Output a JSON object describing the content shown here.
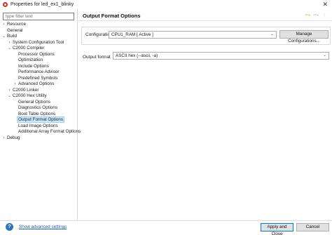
{
  "window": {
    "title": "Properties for led_ex1_blinky",
    "close_glyph": "✕"
  },
  "filter": {
    "placeholder": "type filter text",
    "value": ""
  },
  "tree": [
    {
      "label": "Resource",
      "toggle": "›",
      "depth": 0
    },
    {
      "label": "General",
      "toggle": "",
      "depth": 0
    },
    {
      "label": "Build",
      "toggle": "⌄",
      "depth": 0
    },
    {
      "label": "System Configuration Tool",
      "toggle": "›",
      "depth": 1
    },
    {
      "label": "C2000 Compiler",
      "toggle": "⌄",
      "depth": 1
    },
    {
      "label": "Processor Options",
      "toggle": "",
      "depth": 2
    },
    {
      "label": "Optimization",
      "toggle": "",
      "depth": 2
    },
    {
      "label": "Include Options",
      "toggle": "",
      "depth": 2
    },
    {
      "label": "Performance Advisor",
      "toggle": "",
      "depth": 2
    },
    {
      "label": "Predefined Symbols",
      "toggle": "",
      "depth": 2
    },
    {
      "label": "Advanced Options",
      "toggle": "›",
      "depth": 2
    },
    {
      "label": "C2000 Linker",
      "toggle": "›",
      "depth": 1
    },
    {
      "label": "C2000 Hex Utility",
      "toggle": "⌄",
      "depth": 1
    },
    {
      "label": "General Options",
      "toggle": "",
      "depth": 2
    },
    {
      "label": "Diagnostics Options",
      "toggle": "",
      "depth": 2
    },
    {
      "label": "Boot Table Options",
      "toggle": "",
      "depth": 2
    },
    {
      "label": "Output Format Options",
      "toggle": "",
      "depth": 2,
      "selected": true
    },
    {
      "label": "Load Image Options",
      "toggle": "",
      "depth": 2
    },
    {
      "label": "Additional Array Format Options",
      "toggle": "",
      "depth": 2
    },
    {
      "label": "Debug",
      "toggle": "›",
      "depth": 0
    }
  ],
  "page": {
    "title": "Output Format Options",
    "nav": {
      "back": "⇦",
      "back_menu": "▾",
      "forward": "⇨",
      "forward_menu": "▾",
      "more": "⋮"
    }
  },
  "configuration": {
    "label": "Configuration:",
    "value": "CPU1_RAM  [ Active ]",
    "manage_label": "Manage Configurations..."
  },
  "output_format": {
    "label": "Output format",
    "value": "ASCII hex (--ascii, -a)"
  },
  "footer": {
    "help_glyph": "?",
    "advanced_link": "Show advanced settings",
    "apply_close_label": "Apply and Close",
    "cancel_label": "Cancel"
  },
  "icons": {
    "chevron": "⌄"
  },
  "colors": {
    "selection": "#cce8ff",
    "link": "#1a5fb4",
    "nav_arrow": "#e2a21a",
    "help": "#2f76c1",
    "app_icon": "#d22b2b"
  }
}
